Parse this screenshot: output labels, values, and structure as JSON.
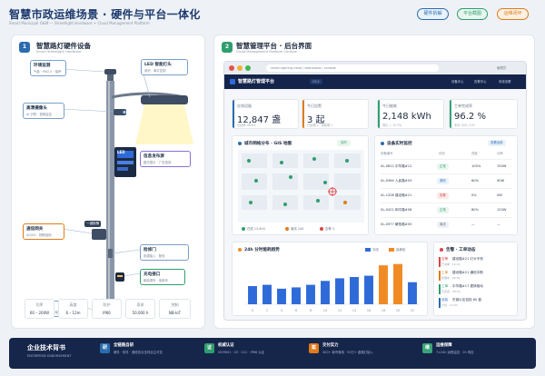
{
  "header": {
    "title": "智慧市政运维场景 · 硬件与平台一体化",
    "subtitle": "Smart Municipal O&M — Streetlight Hardware + Cloud Management Platform",
    "pills": [
      {
        "label": "硬件拆解",
        "color": "#2b6cb0"
      },
      {
        "label": "平台截图",
        "color": "#2f9e6e"
      },
      {
        "label": "运维闭环",
        "color": "#e07b1a"
      }
    ]
  },
  "left_panel": {
    "badge": "1",
    "title": "智慧路灯硬件设备",
    "subtitle": "Smart Streetlight Hardware",
    "callouts": {
      "env": {
        "title": "环境监测",
        "desc": "气象 · PM2.5 · 噪声"
      },
      "led": {
        "title": "LED 智能灯头",
        "desc": "调光 · 单灯控制"
      },
      "cam": {
        "title": "高清摄像头",
        "desc": "AI 识别 · 视频监控"
      },
      "info": {
        "title": "信息发布屏",
        "desc": "路况提示 · 广告投放"
      },
      "gw": {
        "title": "通信网关",
        "desc": "4G/5G · 物联组网"
      },
      "sos": {
        "title": "一键报警",
        "desc": ""
      },
      "door": {
        "title": "检修门",
        "desc": "电源接入 · 配电"
      },
      "ev": {
        "title": "充电接口",
        "desc": "新能源车 · 电单车"
      },
      "base": {
        "title": "法兰底座",
        "desc": "预埋安装 · 接地保护"
      }
    },
    "screen_text": "LED",
    "specs": [
      {
        "label": "功率",
        "value": "60 – 200W"
      },
      {
        "label": "高度",
        "value": "6 – 12m"
      },
      {
        "label": "防护",
        "value": "IP66"
      },
      {
        "label": "寿命",
        "value": "50,000 h"
      },
      {
        "label": "控制",
        "value": "NB-IoT"
      }
    ]
  },
  "right_panel": {
    "badge": "2",
    "title": "智慧管理平台 · 后台界面",
    "subtitle": "Cloud Management Platform Console",
    "browser": {
      "url": "smart-lighting.cloud / dashboard / console",
      "user": "管理员"
    },
    "app": {
      "name": "智慧路灯管理平台",
      "tag": "V3.2",
      "nav": [
        "设备中心",
        "告警中心",
        "系统设置"
      ]
    },
    "kpis": [
      {
        "label": "在线设备",
        "value": "12,847 盏",
        "sub": "在线率 98.6%",
        "color": "#2b6cb0"
      },
      {
        "label": "今日告警",
        "value": "3 起",
        "sub": "已处理 2 · 待处理 1",
        "color": "#e07b1a"
      },
      {
        "label": "今日能耗",
        "value": "2,148 kWh",
        "sub": "同比 ↓ 12.3%",
        "color": "#2f9e6e"
      },
      {
        "label": "工单完成率",
        "value": "96.2 %",
        "sub": "本月 128 / 133",
        "color": "#3aa37a"
      }
    ],
    "map": {
      "title": "城市网格分布 · GIS 地图",
      "tag": "实时",
      "legend": [
        {
          "label": "在线 12,604",
          "color": "#2f9e6e"
        },
        {
          "label": "离线 244",
          "color": "#e07b1a"
        },
        {
          "label": "告警 3",
          "color": "#d94545"
        }
      ]
    },
    "device_table": {
      "title": "设备实时监控",
      "tag": "查看全部",
      "columns": [
        "设备编号",
        "状态",
        "亮度",
        "功率"
      ],
      "rows": [
        {
          "id": "XL-0812 中华路#12",
          "status": "正常",
          "status_color": "#2f9e6e",
          "brightness": "100%",
          "power": "150W"
        },
        {
          "id": "XL-0364 人民路#03",
          "status": "调光",
          "status_color": "#2b6cb0",
          "brightness": "60%",
          "power": "90W"
        },
        {
          "id": "XL-1208 建设路#21",
          "status": "告警",
          "status_color": "#d94545",
          "brightness": "0%",
          "power": "0W"
        },
        {
          "id": "XL-0421 和平路#08",
          "status": "正常",
          "status_color": "#2f9e6e",
          "brightness": "80%",
          "power": "120W"
        },
        {
          "id": "XL-0977 解放路#05",
          "status": "离线",
          "status_color": "#8a96a8",
          "brightness": "—",
          "power": "—"
        }
      ]
    },
    "energy_chart": {
      "title": "24h 分时能耗趋势",
      "legend": [
        {
          "label": "平段",
          "color": "#2f6bd8"
        },
        {
          "label": "高峰段",
          "color": "#f08a24"
        }
      ]
    },
    "alarm_list": {
      "title": "告警 · 工单动态",
      "items": [
        {
          "type": "告警",
          "text": "建设路#21 灯头不亮",
          "meta": "已派单 · 10:24",
          "color": "#d94545"
        },
        {
          "type": "工单",
          "text": "建设路#21 通信中断",
          "meta": "处理中 · 09:52",
          "color": "#e07b1a"
        },
        {
          "type": "工单",
          "text": "中华路#17 更换驱动",
          "meta": "已完成 · 08:40",
          "color": "#2f9e6e"
        },
        {
          "type": "巡检",
          "text": "东部片区巡检 60 盏",
          "meta": "计划 · 14:00",
          "color": "#2b6cb0"
        }
      ]
    }
  },
  "chart_data": {
    "type": "bar",
    "title": "24h 分时能耗趋势",
    "categories": [
      "0",
      "2",
      "4",
      "6",
      "8",
      "10",
      "12",
      "14",
      "16",
      "18",
      "20",
      "22"
    ],
    "series": [
      {
        "name": "平段",
        "values": [
          28,
          30,
          24,
          26,
          30,
          36,
          40,
          42,
          44,
          0,
          0,
          34
        ]
      },
      {
        "name": "高峰段",
        "values": [
          0,
          0,
          0,
          0,
          0,
          0,
          0,
          0,
          0,
          60,
          62,
          0
        ]
      }
    ],
    "xlabel": "",
    "ylabel": "",
    "ylim": [
      0,
      70
    ]
  },
  "footer": {
    "title": "企业技术背书",
    "subtitle": "ENTERPRISE ENDORSEMENT",
    "items": [
      {
        "icon": "研",
        "title": "全链路自研",
        "desc": "硬件 · 软件 · 通信协议全栈自主可控",
        "color": "#2b6cb0"
      },
      {
        "icon": "证",
        "title": "权威认证",
        "desc": "ISO9001 · CE · CCC · IP66 认证",
        "color": "#2f9e6e"
      },
      {
        "icon": "案",
        "title": "交付实力",
        "desc": "300+ 城市落地 · 50万+ 盏路灯接入",
        "color": "#e07b1a"
      },
      {
        "icon": "维",
        "title": "运维保障",
        "desc": "7×24h 远程监控 · 2h 响应",
        "color": "#3aa37a"
      }
    ]
  }
}
